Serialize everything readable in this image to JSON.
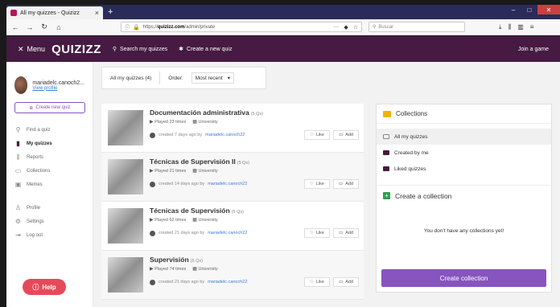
{
  "browser": {
    "tab_title": "All my quizzes - Quizizz",
    "tab_close": "×",
    "new_tab": "+",
    "url_prefix": "https://",
    "url_domain": "quizizz.com",
    "url_path": "/admin/private",
    "url_more": "···",
    "search_placeholder": "Buscar"
  },
  "header": {
    "menu_label": "Menu",
    "logo": "QUIZIZZ",
    "search_link": "Search my quizzes",
    "create_link": "Create a new quiz",
    "join_link": "Join a game"
  },
  "sidebar": {
    "user_name": "mariadelc.canoch2...",
    "view_profile": "View profile",
    "create_quiz": "Create new quiz",
    "items": [
      {
        "label": "Find a quiz",
        "icon": "search-icon",
        "glyph": "⚲"
      },
      {
        "label": "My quizzes",
        "icon": "quiz-icon",
        "glyph": "▮",
        "active": true
      },
      {
        "label": "Reports",
        "icon": "reports-icon",
        "glyph": "⫼"
      },
      {
        "label": "Collections",
        "icon": "folder-icon",
        "glyph": "▭"
      },
      {
        "label": "Memes",
        "icon": "image-icon",
        "glyph": "▣"
      }
    ],
    "items2": [
      {
        "label": "Profile",
        "icon": "profile-icon",
        "glyph": "♙"
      },
      {
        "label": "Settings",
        "icon": "gear-icon",
        "glyph": "⚙"
      },
      {
        "label": "Log out",
        "icon": "logout-icon",
        "glyph": "⇥"
      }
    ],
    "help": "Help"
  },
  "filter": {
    "count_label": "All my quizzes (4)",
    "order_label": "Order:",
    "order_value": "Most recent"
  },
  "quizzes": [
    {
      "title": "Documentación administrativa",
      "qs": "(5 Qs)",
      "played": "Played 23 times",
      "level": "University",
      "created": "created 7 days ago by",
      "author": "mariadelc.canoch22",
      "like": "Like",
      "add": "Add"
    },
    {
      "title": "Técnicas de Supervisión II",
      "qs": "(5 Qs)",
      "played": "Played 21 times",
      "level": "University",
      "created": "created 14 days ago by",
      "author": "mariadelc.canoch22",
      "like": "Like",
      "add": "Add"
    },
    {
      "title": "Técnicas de Supervisión",
      "qs": "(5 Qs)",
      "played": "Played 62 times",
      "level": "University",
      "created": "created 21 days ago by",
      "author": "mariadelc.canoch22",
      "like": "Like",
      "add": "Add"
    },
    {
      "title": "Supervisión",
      "qs": "(5 Qs)",
      "played": "Played 74 times",
      "level": "University",
      "created": "created 21 days ago by",
      "author": "mariadelc.canoch22",
      "like": "Like",
      "add": "Add"
    }
  ],
  "collections": {
    "title": "Collections",
    "items": [
      "All my quizzes",
      "Created by me",
      "Liked quizzes"
    ],
    "create": "Create a collection",
    "empty": "You don't have any collections yet!",
    "button": "Create collection"
  }
}
